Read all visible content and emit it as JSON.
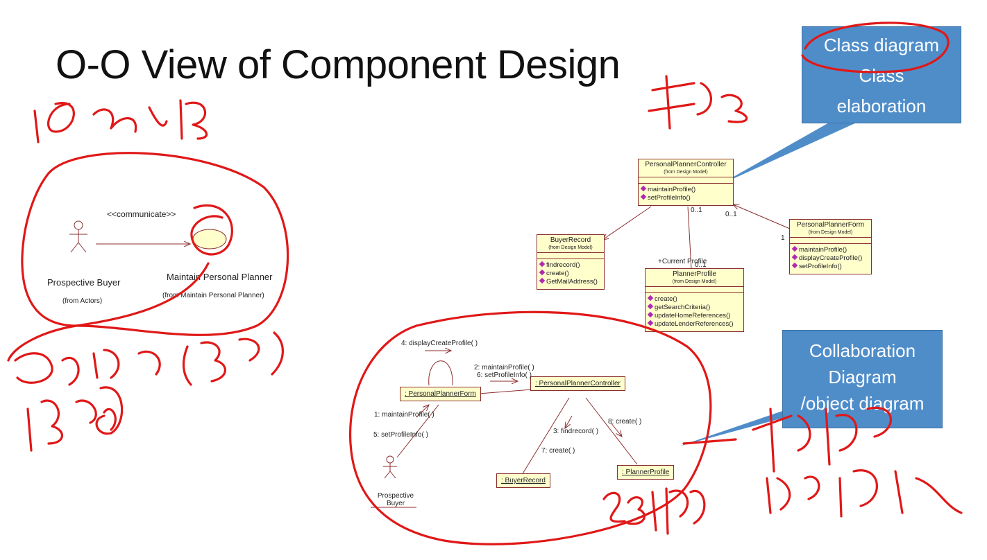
{
  "slide": {
    "title": "O-O View of Component Design"
  },
  "use_case": {
    "stereotype": "<<communicate>>",
    "actor_name": "Prospective Buyer",
    "actor_from": "(from Actors)",
    "use_case_name": "Maintain Personal Planner",
    "use_case_from": "(from Maintain Personal Planner)"
  },
  "class_diagram": {
    "classes": [
      {
        "name": "PersonalPlannerController",
        "from": "(from Design Model)",
        "ops": [
          "maintainProfile()",
          "setProfileInfo()"
        ]
      },
      {
        "name": "BuyerRecord",
        "from": "(from Design Model)",
        "ops": [
          "findrecord()",
          "create()",
          "GetMailAddress()"
        ]
      },
      {
        "name": "PlannerProfile",
        "from": "(from Design Model)",
        "ops": [
          "create()",
          "getSearchCriteria()",
          "updateHomeReferences()",
          "updateLenderReferences()"
        ]
      },
      {
        "name": "PersonalPlannerForm",
        "from": "(from Design Model)",
        "ops": [
          "maintainProfile()",
          "displayCreateProfile()",
          "setProfileInfo()"
        ]
      }
    ],
    "multiplicities": {
      "controller_profile": "0..1",
      "controller_form": "0..1",
      "form_end": "1",
      "profile_end": "0..1"
    },
    "role": "+Current Profile"
  },
  "collaboration": {
    "objects": {
      "form": ": PersonalPlannerForm",
      "controller": ": PersonalPlannerController",
      "buyer": ": BuyerRecord",
      "profile": ": PlannerProfile"
    },
    "messages": {
      "m4": "4: displayCreateProfile( )",
      "m2": "2: maintainProfile( )",
      "m6": "6: setProfileInfo( )",
      "m1": "1: maintainProfile( )",
      "m5": "5: setProfileInfo( )",
      "m3": "3: findrecord( )",
      "m7": "7: create( )",
      "m8": "8: create( )"
    },
    "actor": "Prospective Buyer"
  },
  "callouts": {
    "class": [
      "Class diagram",
      "Class",
      "elaboration"
    ],
    "collab": [
      "Collaboration",
      "Diagram",
      "/object diagram"
    ]
  },
  "colors": {
    "ink": "#e01818",
    "callout": "#4f8dc9",
    "box_fill": "#ffffcc",
    "box_border": "#8b2e2e"
  }
}
